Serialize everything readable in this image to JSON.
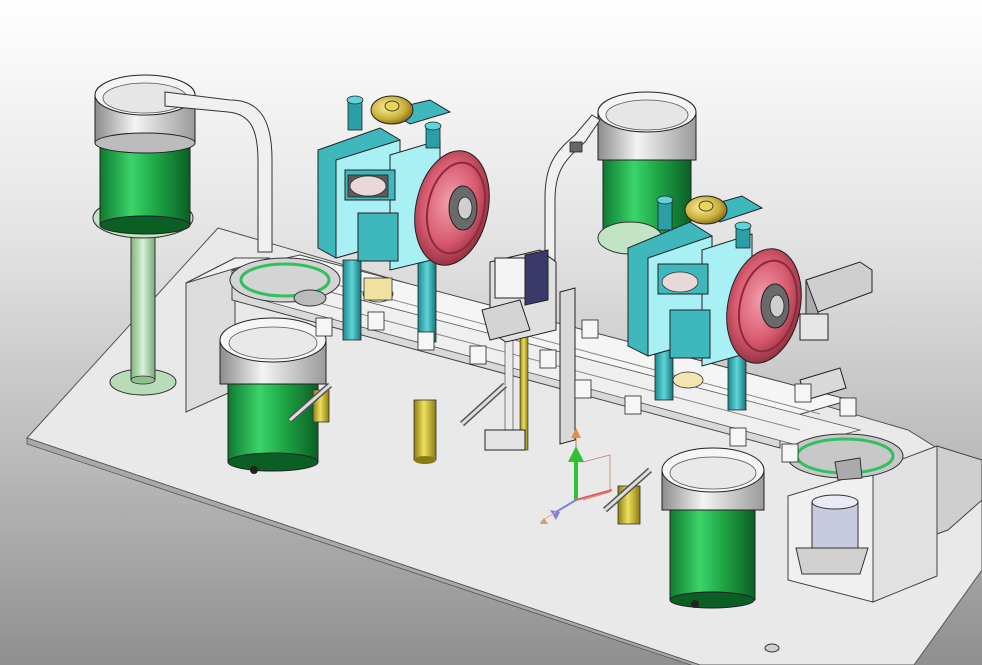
{
  "viewport": {
    "background_top": "#ffffff",
    "background_bottom": "#8f8f8f"
  },
  "colors": {
    "base_plate": "#e9e9e9",
    "base_plate_edge": "#bdbdbd",
    "feeder_bowl_body": "#1faa48",
    "feeder_bowl_rim": "#d9d9d9",
    "press_frame": "#3fb8bd",
    "press_frame_light": "#a8f0f4",
    "flywheel": "#d85a6e",
    "gold_cap": "#c9b03a",
    "brass_cylinder": "#d6c528",
    "support_column": "#a8d4a8",
    "rail": "#f2f2f2",
    "triad_x": "#e06060",
    "triad_y": "#30c030",
    "triad_z": "#8080e0"
  },
  "assembly": {
    "feeder_bowls": [
      "feeder-bowl-top-left",
      "feeder-bowl-mid-left",
      "feeder-bowl-top-right",
      "feeder-bowl-bottom-right"
    ],
    "presses": [
      "press-left",
      "press-right"
    ]
  },
  "coordinate_triad": {
    "axes": [
      "x-axis",
      "y-axis",
      "z-axis"
    ]
  }
}
